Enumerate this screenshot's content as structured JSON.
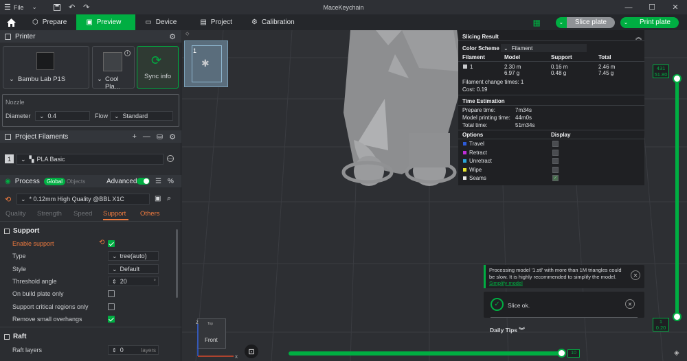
{
  "window": {
    "title": "MaceKeychain",
    "file_menu": "File"
  },
  "nav": {
    "tabs": [
      {
        "label": "Prepare"
      },
      {
        "label": "Preview"
      },
      {
        "label": "Device"
      },
      {
        "label": "Project"
      },
      {
        "label": "Calibration"
      }
    ],
    "slice_label": "Slice plate",
    "print_label": "Print plate"
  },
  "printer": {
    "title": "Printer",
    "model": "Bambu Lab P1S",
    "plate": "Cool Pla...",
    "sync": "Sync info"
  },
  "nozzle": {
    "title": "Nozzle",
    "diameter_label": "Diameter",
    "diameter_value": "0.4",
    "flow_label": "Flow",
    "flow_value": "Standard"
  },
  "filaments": {
    "title": "Project Filaments",
    "index": "1",
    "name": "PLA Basic"
  },
  "process": {
    "title": "Process",
    "global": "Global",
    "objects": "Objects",
    "advanced": "Advanced",
    "preset": "* 0.12mm High Quality @BBL X1C",
    "tabs": [
      "Quality",
      "Strength",
      "Speed",
      "Support",
      "Others"
    ]
  },
  "support": {
    "title": "Support",
    "enable_label": "Enable support",
    "type_label": "Type",
    "type_value": "tree(auto)",
    "style_label": "Style",
    "style_value": "Default",
    "threshold_label": "Threshold angle",
    "threshold_value": "20",
    "threshold_unit": "°",
    "build_plate_label": "On build plate only",
    "critical_label": "Support critical regions only",
    "overhangs_label": "Remove small overhangs"
  },
  "raft": {
    "title": "Raft",
    "layers_label": "Raft layers",
    "layers_value": "0",
    "layers_unit": "layers"
  },
  "plate_thumb": {
    "index": "1"
  },
  "view_cube": {
    "front": "Front",
    "top": "Top"
  },
  "slicing_result": {
    "title": "Slicing Result",
    "color_scheme_label": "Color Scheme",
    "color_scheme_value": "Filament",
    "col_filament": "Filament",
    "col_model": "Model",
    "col_support": "Support",
    "col_total": "Total",
    "row_index": "1",
    "model_m": "2.30 m",
    "model_g": "6.97 g",
    "support_m": "0.16 m",
    "support_g": "0.48 g",
    "total_m": "2.46 m",
    "total_g": "7.45 g",
    "change_times": "Filament change times:  1",
    "cost": "Cost:  0.19",
    "time_title": "Time Estimation",
    "prepare_label": "Prepare time:",
    "prepare_value": "7m34s",
    "model_time_label": "Model printing time:",
    "model_time_value": "44m0s",
    "total_time_label": "Total time:",
    "total_time_value": "51m34s",
    "options_label": "Options",
    "display_label": "Display",
    "options": [
      {
        "name": "Travel",
        "color": "#2d5bd8"
      },
      {
        "name": "Retract",
        "color": "#c02ed8"
      },
      {
        "name": "Unretract",
        "color": "#2aa7d8"
      },
      {
        "name": "Wipe",
        "color": "#e6e62e"
      },
      {
        "name": "Seams",
        "color": "#e8e8e8"
      }
    ]
  },
  "notifications": {
    "warning_text": "Processing model '1.stl' with more than 1M triangles could be slow. It is highly recommended to simplify the model.",
    "warning_link": "Simplify model",
    "slice_ok": "Slice ok.",
    "daily_tips": "Daily Tips"
  },
  "layer_slider": {
    "top_value": "431",
    "top_height": "51.80",
    "bottom_value": "1",
    "bottom_height": "0.20",
    "progress_value": "10"
  },
  "colors": {
    "accent": "#00ae42",
    "orange": "#f07b3f"
  }
}
